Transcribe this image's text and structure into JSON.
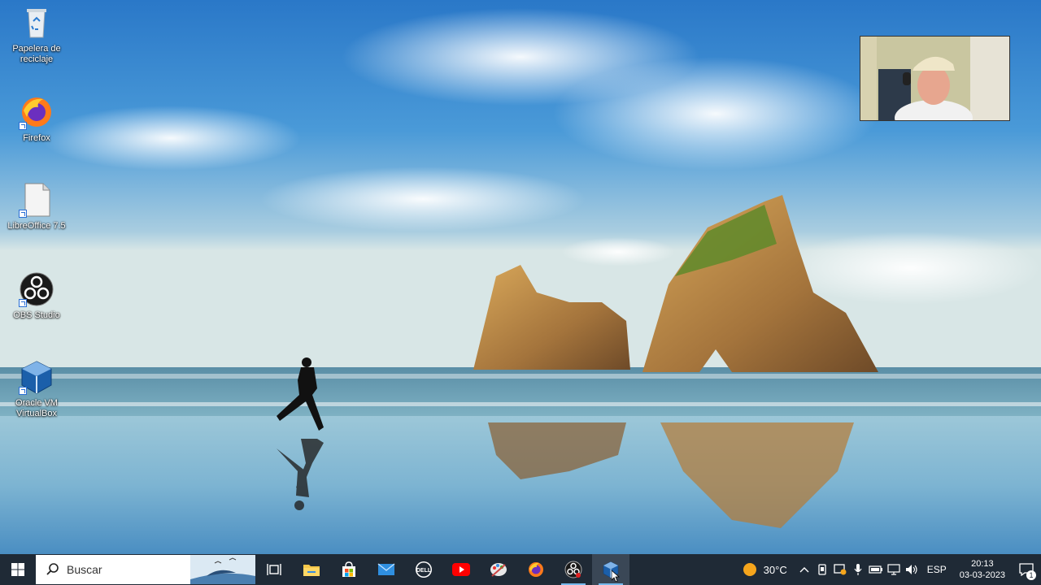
{
  "desktop": {
    "icons": [
      {
        "label": "Papelera de reciclaje",
        "icon": "recycle-bin-icon"
      },
      {
        "label": "Firefox",
        "icon": "firefox-icon"
      },
      {
        "label": "LibreOffice 7.5",
        "icon": "libreoffice-icon"
      },
      {
        "label": "OBS Studio",
        "icon": "obs-icon"
      },
      {
        "label": "Oracle VM VirtualBox",
        "icon": "virtualbox-icon"
      }
    ]
  },
  "taskbar": {
    "search_placeholder": "Buscar",
    "apps": [
      "task-view",
      "file-explorer",
      "microsoft-store",
      "mail",
      "dell",
      "youtube",
      "app-paint",
      "firefox",
      "obs-studio",
      "virtualbox"
    ],
    "colors": {
      "taskbar": "#1f2a36",
      "active_indicator": "#76b9ed"
    }
  },
  "tray": {
    "weather_temp": "30°C",
    "language": "ESP",
    "time": "20:13",
    "date": "03-03-2023",
    "notification_count": "1"
  }
}
